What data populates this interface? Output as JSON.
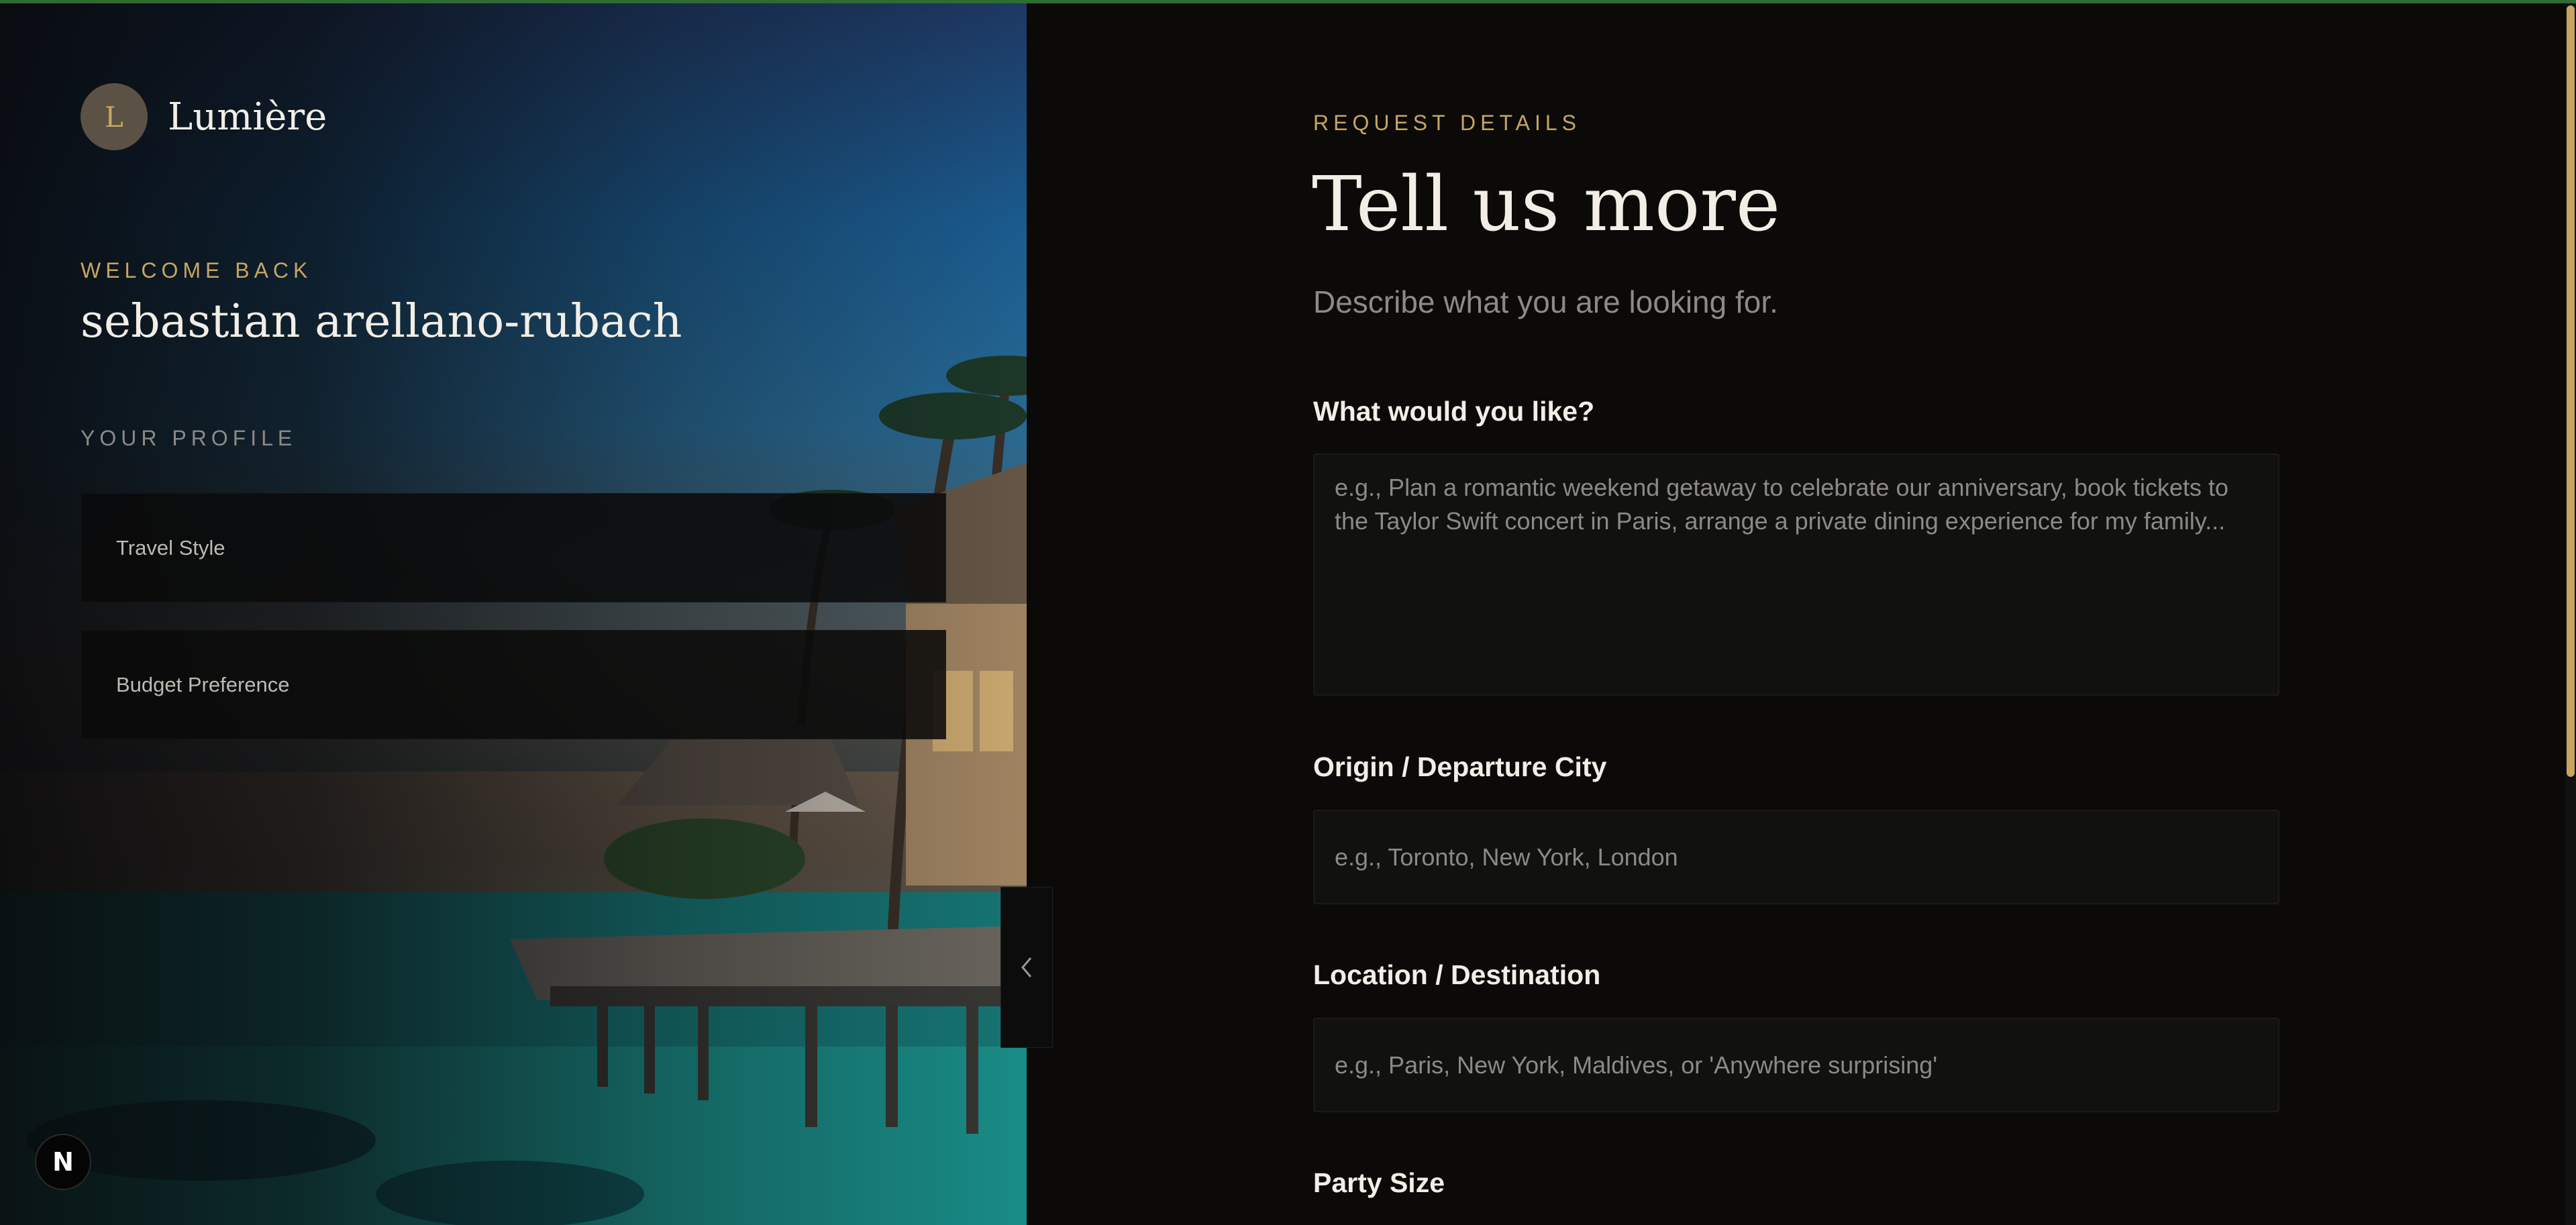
{
  "theme": {
    "accent": "#c7a561",
    "background": "#0b0a09",
    "text": "#f2eee6",
    "muted": "#8d8a86"
  },
  "brand": {
    "initial": "L",
    "name": "Lumière"
  },
  "sidebar": {
    "welcome_label": "WELCOME BACK",
    "username": "sebastian arellano-rubach",
    "profile_label": "YOUR PROFILE",
    "profile_items": [
      {
        "label": "Travel Style"
      },
      {
        "label": "Budget Preference"
      }
    ],
    "collapse_icon": "chevron-left-icon"
  },
  "badge": {
    "letter": "N"
  },
  "form": {
    "eyebrow": "REQUEST DETAILS",
    "title": "Tell us more",
    "subtitle": "Describe what you are looking for.",
    "fields": [
      {
        "label": "What would you like?",
        "placeholder": "e.g., Plan a romantic weekend getaway to celebrate our anniversary, book tickets to the Taylor Swift concert in Paris, arrange a private dining experience for my family..."
      },
      {
        "label": "Origin / Departure City",
        "placeholder": "e.g., Toronto, New York, London"
      },
      {
        "label": "Location / Destination",
        "placeholder": "e.g., Paris, New York, Maldives, or 'Anywhere surprising'"
      },
      {
        "label": "Party Size"
      }
    ]
  }
}
